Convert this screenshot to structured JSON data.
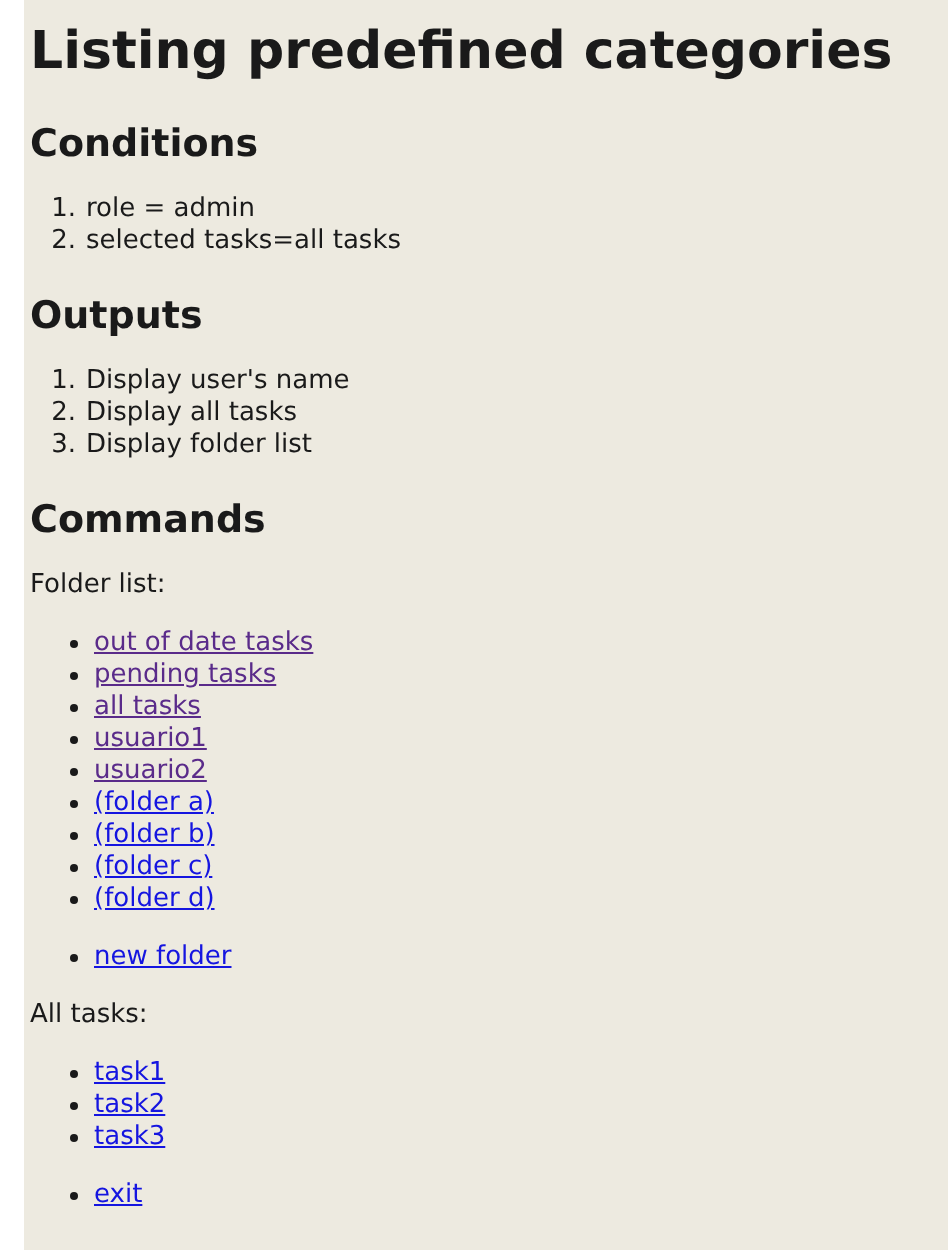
{
  "title": "Listing predefined categories",
  "blocks": [
    {
      "kind": "heading",
      "text": "Conditions"
    },
    {
      "kind": "numbered",
      "items": [
        {
          "number": "1.",
          "text": "role = admin"
        },
        {
          "number": "2.",
          "text": "selected tasks=all tasks"
        }
      ]
    },
    {
      "kind": "heading",
      "text": "Outputs"
    },
    {
      "kind": "numbered",
      "items": [
        {
          "number": "1.",
          "text": "Display user's name"
        },
        {
          "number": "2.",
          "text": "Display all tasks"
        },
        {
          "number": "3.",
          "text": "Display folder list"
        }
      ]
    },
    {
      "kind": "heading",
      "text": "Commands"
    },
    {
      "kind": "label",
      "text": "Folder list:"
    },
    {
      "kind": "links",
      "items": [
        {
          "text": "out of date tasks",
          "visited": true
        },
        {
          "text": "pending tasks",
          "visited": true
        },
        {
          "text": "all tasks",
          "visited": true
        },
        {
          "text": "usuario1",
          "visited": true
        },
        {
          "text": "usuario2",
          "visited": true
        },
        {
          "text": "(folder a)",
          "visited": false
        },
        {
          "text": "(folder b)",
          "visited": false
        },
        {
          "text": "(folder c)",
          "visited": false
        },
        {
          "text": "(folder d)",
          "visited": false
        }
      ]
    },
    {
      "kind": "links",
      "items": [
        {
          "text": "new folder",
          "visited": false
        }
      ]
    },
    {
      "kind": "label",
      "text": "All tasks:"
    },
    {
      "kind": "links",
      "items": [
        {
          "text": "task1",
          "visited": false
        },
        {
          "text": "task2",
          "visited": false
        },
        {
          "text": "task3",
          "visited": false
        }
      ]
    },
    {
      "kind": "links",
      "items": [
        {
          "text": "exit",
          "visited": false
        }
      ]
    }
  ]
}
